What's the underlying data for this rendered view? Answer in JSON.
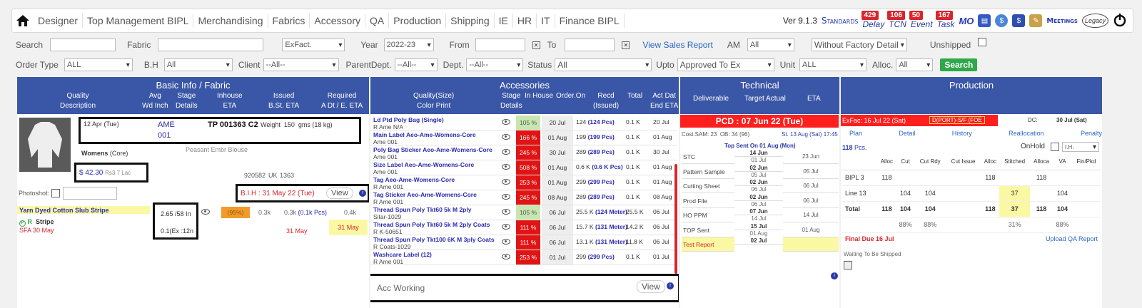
{
  "nav": {
    "menu": [
      "Designer",
      "Top Management BIPL",
      "Merchandising",
      "Fabrics",
      "Accessory",
      "QA",
      "Production",
      "Shipping",
      "IE",
      "HR",
      "IT",
      "Finance BIPL"
    ],
    "version": "Ver 9.1.3",
    "standards": "Standards",
    "delay": {
      "label": "Delay",
      "count": "429"
    },
    "tcn": {
      "label": "TCN",
      "count": "106"
    },
    "event": {
      "label": "Event",
      "count": "50"
    },
    "task": {
      "label": "Task",
      "count": "167"
    },
    "mo": "MO",
    "meetings": "Meetings",
    "legacy": "Legacy"
  },
  "filters": {
    "search_label": "Search",
    "fabric_label": "Fabric",
    "exfact": "ExFact.",
    "year_label": "Year",
    "year": "2022-23",
    "from_label": "From",
    "to_label": "To",
    "view_sales": "View Sales Report",
    "am_label": "AM",
    "am": "All",
    "factory_detail": "Without Factory Detail",
    "unshipped": "Unshipped",
    "order_type_label": "Order Type",
    "order_type": "ALL",
    "bh_label": "B.H",
    "bh": "All",
    "client_label": "Client",
    "client": "--All--",
    "parent_label": "ParentDept.",
    "parent": "--All--",
    "dept_label": "Dept.",
    "dept": "--All--",
    "status_label": "Status",
    "status": "All",
    "upto_label": "Upto",
    "upto": "Approved To Ex",
    "unit_label": "Unit",
    "unit": "ALL",
    "alloc_label": "Alloc.",
    "alloc": "All",
    "search_btn": "Search"
  },
  "basic": {
    "title": "Basic Info / Fabric",
    "cols": [
      [
        "Quality",
        "Description"
      ],
      [
        "Avg",
        "Wd Inch"
      ],
      [
        "Stage",
        "Details"
      ],
      [
        "Inhouse",
        "ETA"
      ],
      [
        "Issued",
        "B.St. ETA"
      ],
      [
        "Required",
        "A Dt / E. ETA"
      ]
    ],
    "date": "12 Apr (Tue)",
    "ame": "AME",
    "code": "001",
    "tp": "TP 001363 C2",
    "weight_label": "Weight",
    "weight": "150",
    "weight_unit": "gms (18 kg)",
    "dept": "Womens",
    "dept_sub": "(Core)",
    "style": "Peasant Embr Blouse",
    "price": "$ 42.30",
    "price_lac": "Rs3.7 Lac",
    "num1": "920582",
    "uk": "UK",
    "num2": "1363",
    "photoshot": "Photoshot:",
    "bih": "B.I.H : 31 May 22 (Tue)",
    "view": "View",
    "fabric": "Yarn Dyed Cotton Slub Stripe",
    "stripe": "Stripe",
    "sfa": "SFA 30 May",
    "width": "2.65 /58 In",
    "ex": "0.1(Ex :12n",
    "pct": "(95%)",
    "q1": "0.3k",
    "q2": "0.3k",
    "q2b": "(0.1k Pcs)",
    "q3": "0.4k",
    "may1": "31 May",
    "may2": "31 May"
  },
  "acc": {
    "title": "Accessories",
    "cols": [
      [
        "Quality(Size)",
        "Color Print"
      ],
      [
        "Stage",
        "Details"
      ],
      [
        "In House",
        ""
      ],
      [
        "Order.On",
        ""
      ],
      [
        "Recd",
        "(Issued)"
      ],
      [
        "Total",
        ""
      ],
      [
        "Act Dat",
        "End ETA"
      ]
    ],
    "rows": [
      {
        "name": "Ld Ptd Poly Bag (Single)",
        "sub": "R  Ame N/A",
        "pct": "105 %",
        "red": false,
        "date": "20 Jul",
        "recd": "124",
        "recd2": "(124 Pcs)",
        "total": "0.1 K",
        "end": "20 Jul"
      },
      {
        "name": "Main Label Aeo-Ame-Womens-Core",
        "sub": "Ame 001",
        "pct": "166 %",
        "red": true,
        "date": "01 Aug",
        "recd": "199",
        "recd2": "(199 Pcs)",
        "total": "0.1 K",
        "end": "01 Aug"
      },
      {
        "name": "Poly Bag Sticker Aeo-Ame-Womens-Core",
        "sub": "Ame 001",
        "pct": "245 %",
        "red": true,
        "date": "30 Jul",
        "recd": "289",
        "recd2": "(289 Pcs)",
        "total": "0.1 K",
        "end": "30 Jul"
      },
      {
        "name": "Size Label Aeo-Ame-Womens-Core",
        "sub": "Ame 001",
        "pct": "508 %",
        "red": true,
        "date": "01 Aug",
        "recd": "0.6 K",
        "recd2": "(0.6 K Pcs)",
        "total": "0.1 K",
        "end": "01 Aug"
      },
      {
        "name": "Tag Aeo-Ame-Womens-Core",
        "sub": "R  Ame 001",
        "pct": "253 %",
        "red": true,
        "date": "01 Aug",
        "recd": "299",
        "recd2": "(299 Pcs)",
        "total": "0.1 K",
        "end": "01 Aug"
      },
      {
        "name": "Tag Sticker Aeo-Ame-Womens-Core",
        "sub": "R  Ame 001",
        "pct": "245 %",
        "red": true,
        "date": "08 Aug",
        "recd": "289",
        "recd2": "(289 Pcs)",
        "total": "0.1 K",
        "end": "08 Aug"
      },
      {
        "name": "Thread Spun Poly Tkt60 5k M 2ply",
        "sub": "Sitar-1029",
        "pct": "105 %",
        "red": false,
        "date": "06 Jul",
        "recd": "25.5 K",
        "recd2": "(124 Meter)",
        "total": "25.5 K",
        "end": "06 Jul"
      },
      {
        "name": "Thread Spun Poly Tkt60 5k M 2ply Coats",
        "sub": "R  K-50651",
        "pct": "111 %",
        "red": true,
        "date": "06 Jul",
        "recd": "15.7 K",
        "recd2": "(131 Meter)",
        "total": "14.2 K",
        "end": "06 Jul"
      },
      {
        "name": "Thread Spun Poly Tkt100 6K M 3ply Coats",
        "sub": "R  Coats-1029",
        "pct": "111 %",
        "red": true,
        "date": "06 Jul",
        "recd": "13.1 K",
        "recd2": "(131 Meter)",
        "total": "11.8 K",
        "end": "06 Jul"
      },
      {
        "name": "Washcare Label (12)",
        "sub": "R  Ame 001",
        "pct": "253 %",
        "red": true,
        "date": "01 Jul",
        "recd": "299",
        "recd2": "(299 Pcs)",
        "total": "0.1 K",
        "end": "01 Jul"
      }
    ],
    "acc_working": "Acc Working",
    "view": "View"
  },
  "tech": {
    "title": "Technical",
    "cols": [
      "Deliverable",
      "Target Actual",
      "ETA"
    ],
    "pcd": "PCD : 07 Jun 22 (Tue)",
    "sam": "Cost.SAM: 23",
    "ob": "OB: 34 (96)",
    "st": "St. 13 Aug (Sat) 17:45",
    "top_sent": "Top Sent On 01 Aug (Mon)",
    "rows": [
      {
        "name": "STC",
        "t": "14 Jun",
        "a": "01 Jul",
        "eta": "23 Jun"
      },
      {
        "name": "Pattern Sample",
        "t": "02 Jun",
        "a": "05 Jul",
        "eta": "05 Jul"
      },
      {
        "name": "Cutting Sheet",
        "t": "02 Jun",
        "a": "06 Jul",
        "eta": "06 Jul"
      },
      {
        "name": "Prod File",
        "t": "02 Jun",
        "a": "06 Jul",
        "eta": "06 Jul"
      },
      {
        "name": "HO PPM",
        "t": "07 Jun",
        "a": "14 Jul",
        "eta": "14 Jul"
      },
      {
        "name": "TOP Sent",
        "t": "15 Jul",
        "a": "01 Aug",
        "eta": "01 Aug"
      },
      {
        "name": "Test Report",
        "t": "02 Jul",
        "a": "",
        "eta": ""
      }
    ]
  },
  "prod": {
    "title": "Production",
    "exfac": "ExFac: 16 Jul 22 (Sat)",
    "port": "D(PORT)-S/F (FOE",
    "dc_label": "DC:",
    "dc": "30 Jul (Sat)",
    "links": [
      "Plan",
      "Detail",
      "History",
      "Reallocation",
      "Penalty"
    ],
    "pcs": "118",
    "pcs_unit": "Pcs.",
    "onhold": "OnHold",
    "ih": "I.H.",
    "cols": [
      "",
      "Alloc",
      "Cut",
      "Cut Rdy",
      "Cut Issue",
      "Alloc",
      "Stitched",
      "Alloca",
      "VA",
      "Fin/Pkd"
    ],
    "rows": [
      [
        "BIPL 3",
        "118",
        "",
        "",
        "",
        "118",
        "",
        "118",
        "",
        ""
      ],
      [
        "Line 13",
        "",
        "104",
        "104",
        "",
        "",
        "37",
        "",
        "104",
        ""
      ],
      [
        "Total",
        "118",
        "104",
        "104",
        "",
        "118",
        "37",
        "118",
        "104",
        ""
      ],
      [
        "",
        "",
        "88%",
        "88%",
        "",
        "",
        "31%",
        "",
        "88%",
        ""
      ]
    ],
    "final_due": "Final Due 16 Jul",
    "upload": "Upload QA Report",
    "waiting": "Waiting To Be Shipped"
  }
}
